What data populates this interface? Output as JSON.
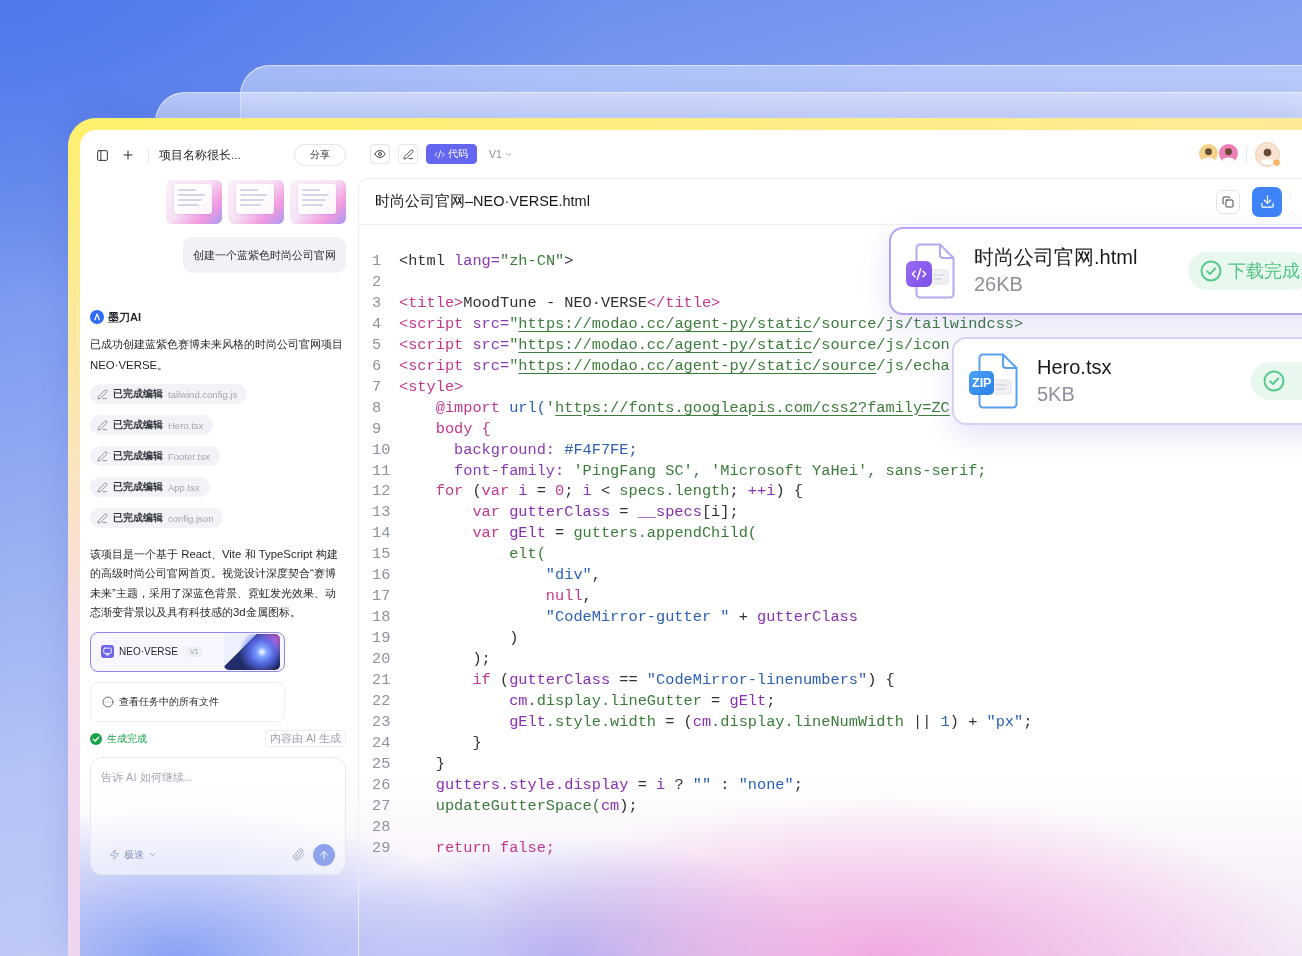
{
  "project_panel": {
    "title": "项目名称很长...",
    "share_button": "分享",
    "attachments": [
      {
        "kind": "image"
      },
      {
        "kind": "image"
      },
      {
        "kind": "image"
      }
    ],
    "user_message": "创建一个蓝紫色时尚公司官网",
    "assistant": {
      "name": "墨刀AI",
      "summary": "已成功创建蓝紫色赛博未来风格的时尚公司官网项目 NEO·VERSE。",
      "edits": [
        {
          "status": "已完成编辑",
          "file": "tailwind.config.js"
        },
        {
          "status": "已完成编辑",
          "file": "Hero.tsx"
        },
        {
          "status": "已完成编辑",
          "file": "Footer.tsx"
        },
        {
          "status": "已完成编辑",
          "file": "App.tsx"
        },
        {
          "status": "已完成编辑",
          "file": "config.json"
        }
      ],
      "description": "该项目是一个基于 React、Vite 和 TypeScript 构建的高级时尚公司官网首页。视觉设计深度契合“赛博未来”主题，采用了深蓝色背景、霓虹发光效果、动态渐变背景以及具有科技感的3d金属图标。",
      "project_card": {
        "name": "NEO·VERSE",
        "version": "V1"
      },
      "files_link": "查看任务中的所有文件",
      "status": "生成完成",
      "ai_notice": "内容由 AI 生成"
    },
    "composer": {
      "placeholder": "告诉 AI 如何继续...",
      "mode": "极速"
    }
  },
  "editor": {
    "toolbar": {
      "views": [
        {
          "kind": "preview",
          "selected": false
        },
        {
          "kind": "edit",
          "selected": false
        },
        {
          "kind": "code",
          "label": "代码",
          "selected": true
        }
      ],
      "version": "V1",
      "avatars": [
        {
          "kind": "stacked",
          "badge": false
        },
        {
          "kind": "stacked",
          "badge": false
        },
        {
          "kind": "single",
          "badge": true
        }
      ]
    },
    "file_name": "时尚公司官网–NEO·VERSE.html",
    "code_lines": [
      {
        "number": "1",
        "tokens": [
          {
            "kind": "text",
            "text": "<html "
          },
          {
            "kind": "attr",
            "text": "lang="
          },
          {
            "kind": "value",
            "text": "\"zh-CN\""
          },
          {
            "kind": "text",
            "text": ">"
          }
        ]
      },
      {
        "number": "2"
      },
      {
        "number": "3",
        "tokens": [
          {
            "kind": "tag",
            "text": "<title>"
          },
          {
            "kind": "text",
            "text": "MoodTune - NEO·VERSE"
          },
          {
            "kind": "tag",
            "text": "</title>"
          }
        ]
      },
      {
        "number": "4",
        "tokens": [
          {
            "kind": "tag",
            "text": "<script "
          },
          {
            "kind": "attr",
            "text": "src="
          },
          {
            "kind": "value",
            "text": "\""
          },
          {
            "kind": "link",
            "text": "https://modao.cc/agent-py/static"
          },
          {
            "kind": "value",
            "text": "/source/js/tailwindcss>"
          }
        ]
      },
      {
        "number": "5",
        "tokens": [
          {
            "kind": "tag",
            "text": "<script "
          },
          {
            "kind": "attr",
            "text": "src="
          },
          {
            "kind": "value",
            "text": "\""
          },
          {
            "kind": "link",
            "text": "https://modao.cc/agent-py/static"
          },
          {
            "kind": "value",
            "text": "/source/js/icon"
          }
        ]
      },
      {
        "number": "6",
        "tokens": [
          {
            "kind": "tag",
            "text": "<script "
          },
          {
            "kind": "attr",
            "text": "src="
          },
          {
            "kind": "value",
            "text": "\""
          },
          {
            "kind": "link",
            "text": "https://modao.cc/agent-py/static/source"
          },
          {
            "kind": "value",
            "text": "/js/echa"
          }
        ]
      },
      {
        "number": "7",
        "tokens": [
          {
            "kind": "tag",
            "text": "<style>"
          }
        ],
        "children": [
          {
            "number": "8",
            "tokens": [
              {
                "kind": "tag",
                "text": "@import "
              },
              {
                "kind": "string",
                "text": "url("
              },
              {
                "kind": "value",
                "text": "'"
              },
              {
                "kind": "link",
                "text": "https://fonts.googleapis.com/css2?family=ZC"
              }
            ]
          },
          {
            "number": "9",
            "kind": "css",
            "tokens": [
              {
                "kind": "tag",
                "text": "body {"
              }
            ],
            "children": [
              {
                "number": "10",
                "tokens": [
                  {
                    "kind": "attr",
                    "text": "background: "
                  },
                  {
                    "kind": "string",
                    "text": "#F4F7FE;"
                  }
                ]
              },
              {
                "number": "11",
                "tokens": [
                  {
                    "kind": "attr",
                    "text": "font-family: "
                  },
                  {
                    "kind": "value",
                    "text": "'PingFang SC', 'Microsoft YaHei', sans-serif;"
                  }
                ]
              }
            ]
          },
          {
            "number": "12",
            "tokens": [
              {
                "kind": "keyword",
                "text": "for "
              },
              {
                "kind": "text",
                "text": "("
              },
              {
                "kind": "keyword",
                "text": "var "
              },
              {
                "kind": "variable",
                "text": "i "
              },
              {
                "kind": "text",
                "text": "= "
              },
              {
                "kind": "keyword",
                "text": "0"
              },
              {
                "kind": "text",
                "text": "; "
              },
              {
                "kind": "variable",
                "text": "i "
              },
              {
                "kind": "text",
                "text": "< "
              },
              {
                "kind": "property",
                "text": "specs.length"
              },
              {
                "kind": "text",
                "text": "; "
              },
              {
                "kind": "variable",
                "text": "++i"
              },
              {
                "kind": "text",
                "text": ") {"
              }
            ],
            "children": [
              {
                "number": "13",
                "tokens": [
                  {
                    "kind": "keyword",
                    "text": "var "
                  },
                  {
                    "kind": "variable",
                    "text": "gutterClass "
                  },
                  {
                    "kind": "text",
                    "text": "= "
                  },
                  {
                    "kind": "variable",
                    "text": "__specs"
                  },
                  {
                    "kind": "text",
                    "text": "[i];"
                  }
                ]
              },
              {
                "number": "14",
                "tokens": [
                  {
                    "kind": "keyword",
                    "text": "var "
                  },
                  {
                    "kind": "variable",
                    "text": "gElt "
                  },
                  {
                    "kind": "text",
                    "text": "= "
                  },
                  {
                    "kind": "property",
                    "text": "gutters.appendChild("
                  }
                ],
                "children": [
                  {
                    "number": "15",
                    "tokens": [
                      {
                        "kind": "property",
                        "text": "elt("
                      }
                    ],
                    "children": [
                      {
                        "number": "16",
                        "tokens": [
                          {
                            "kind": "string",
                            "text": "\"div\""
                          },
                          {
                            "kind": "text",
                            "text": ","
                          }
                        ]
                      },
                      {
                        "number": "17",
                        "tokens": [
                          {
                            "kind": "keyword",
                            "text": "null"
                          },
                          {
                            "kind": "text",
                            "text": ","
                          }
                        ]
                      },
                      {
                        "number": "18",
                        "tokens": [
                          {
                            "kind": "string",
                            "text": "\"CodeMirror-gutter \""
                          },
                          {
                            "kind": "text",
                            "text": " + "
                          },
                          {
                            "kind": "variable",
                            "text": "gutterClass"
                          }
                        ]
                      }
                    ]
                  },
                  {
                    "number": "19",
                    "tokens": [
                      {
                        "kind": "text",
                        "text": ")"
                      }
                    ]
                  }
                ]
              },
              {
                "number": "20",
                "tokens": [
                  {
                    "kind": "text",
                    "text": ");"
                  }
                ]
              },
              {
                "number": "21",
                "tokens": [
                  {
                    "kind": "keyword",
                    "text": "if "
                  },
                  {
                    "kind": "text",
                    "text": "("
                  },
                  {
                    "kind": "variable",
                    "text": "gutterClass "
                  },
                  {
                    "kind": "text",
                    "text": "== "
                  },
                  {
                    "kind": "string",
                    "text": "\"CodeMirror-linenumbers\""
                  },
                  {
                    "kind": "text",
                    "text": ") {"
                  }
                ],
                "children": [
                  {
                    "number": "22",
                    "tokens": [
                      {
                        "kind": "variable",
                        "text": "cm."
                      },
                      {
                        "kind": "property",
                        "text": "display.lineGutter "
                      },
                      {
                        "kind": "text",
                        "text": "= "
                      },
                      {
                        "kind": "variable",
                        "text": "gElt"
                      },
                      {
                        "kind": "text",
                        "text": ";"
                      }
                    ]
                  },
                  {
                    "number": "23",
                    "tokens": [
                      {
                        "kind": "variable",
                        "text": "gElt"
                      },
                      {
                        "kind": "property",
                        "text": ".style.width "
                      },
                      {
                        "kind": "text",
                        "text": "= ("
                      },
                      {
                        "kind": "variable",
                        "text": "cm"
                      },
                      {
                        "kind": "property",
                        "text": ".display.lineNumWidth "
                      },
                      {
                        "kind": "text",
                        "text": "|| "
                      },
                      {
                        "kind": "string",
                        "text": "1"
                      },
                      {
                        "kind": "text",
                        "text": ") + "
                      },
                      {
                        "kind": "string",
                        "text": "\"px\""
                      },
                      {
                        "kind": "text",
                        "text": ";"
                      }
                    ]
                  }
                ]
              },
              {
                "number": "24",
                "tokens": [
                  {
                    "kind": "text",
                    "text": "}"
                  }
                ]
              }
            ]
          },
          {
            "number": "25",
            "tokens": [
              {
                "kind": "text",
                "text": "}"
              }
            ]
          },
          {
            "number": "26",
            "tokens": [
              {
                "kind": "variable",
                "text": "gutters.style.display "
              },
              {
                "kind": "text",
                "text": "= "
              },
              {
                "kind": "variable",
                "text": "i "
              },
              {
                "kind": "text",
                "text": "? "
              },
              {
                "kind": "string",
                "text": "\"\""
              },
              {
                "kind": "text",
                "text": " : "
              },
              {
                "kind": "string",
                "text": "\"none\""
              },
              {
                "kind": "text",
                "text": ";"
              }
            ]
          },
          {
            "number": "27",
            "tokens": [
              {
                "kind": "property",
                "text": "updateGutterSpace("
              },
              {
                "kind": "variable",
                "text": "cm"
              },
              {
                "kind": "text",
                "text": ");"
              }
            ]
          },
          {
            "number": "28"
          },
          {
            "number": "29",
            "tokens": [
              {
                "kind": "keyword",
                "text": "return false;"
              }
            ]
          }
        ]
      }
    ]
  },
  "download_cards": [
    {
      "kind": "html",
      "name": "时尚公司官网.html",
      "size": "26KB",
      "downloaded": true,
      "status": "下载完成"
    },
    {
      "kind": "zip",
      "badge": "ZIP",
      "name": "Hero.tsx",
      "size": "5KB",
      "downloaded": true
    }
  ]
}
